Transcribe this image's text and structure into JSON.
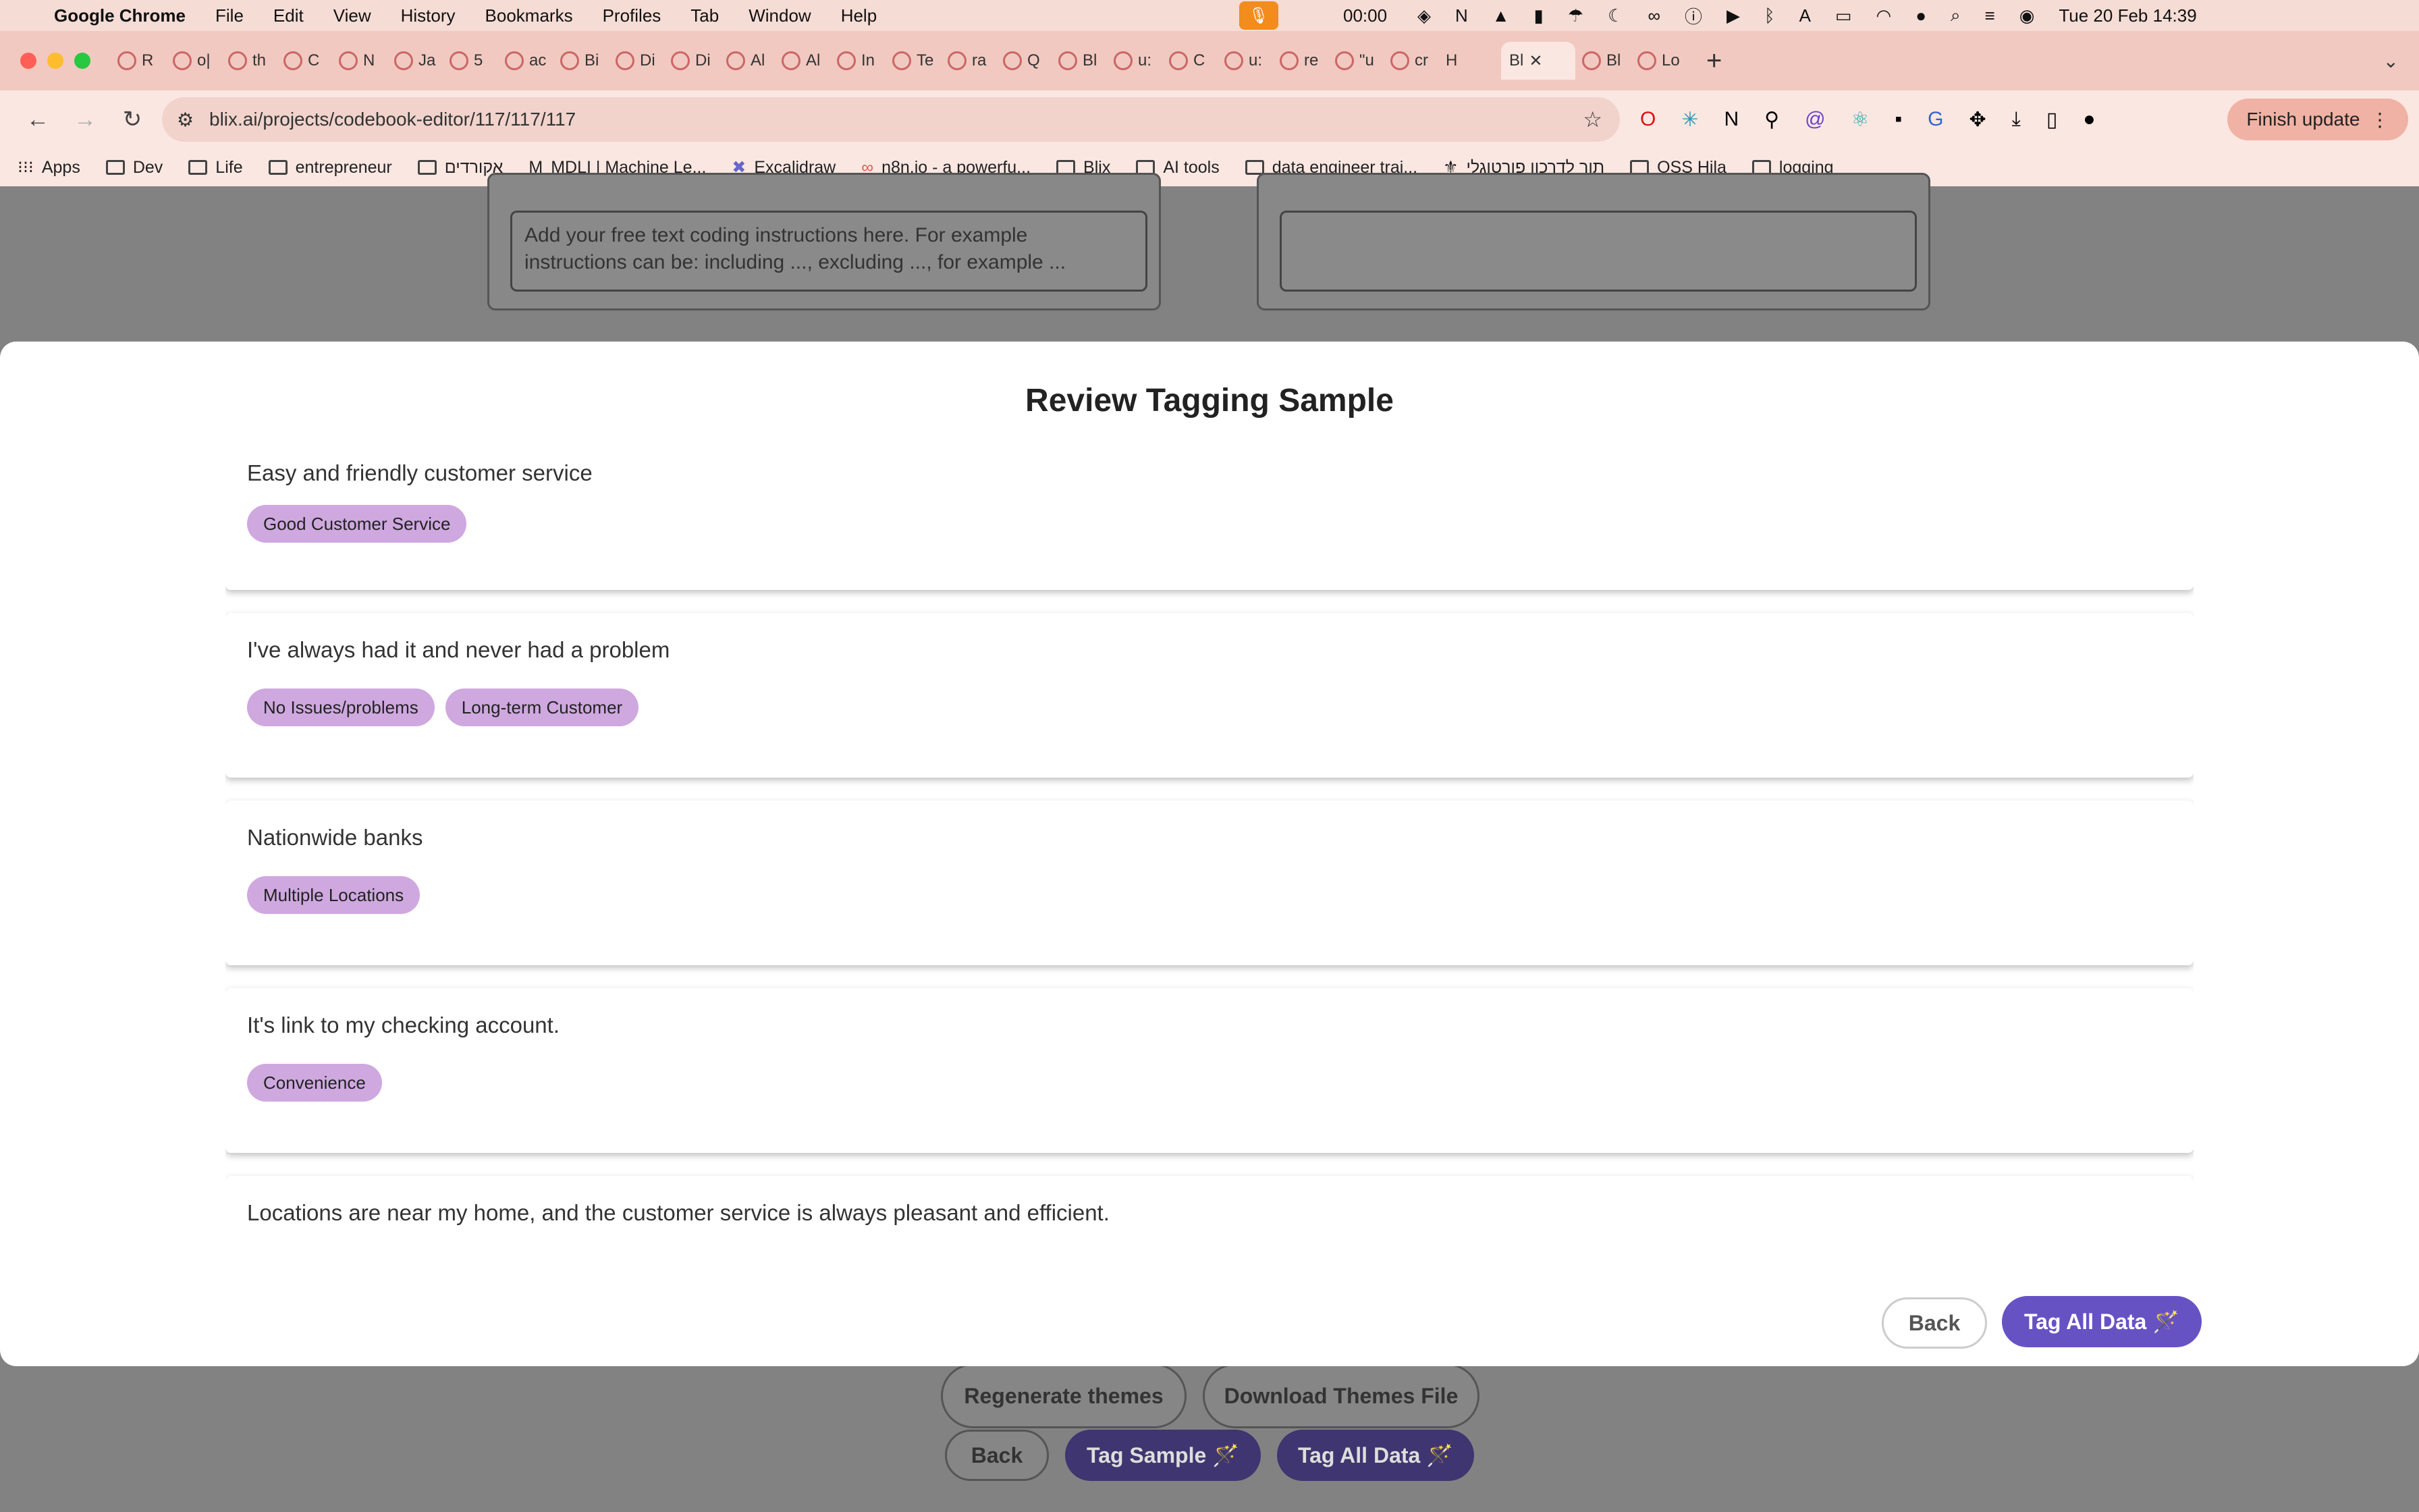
{
  "menubar": {
    "app": "Google Chrome",
    "items": [
      "File",
      "Edit",
      "View",
      "History",
      "Bookmarks",
      "Profiles",
      "Tab",
      "Window",
      "Help"
    ],
    "timer": "00:00",
    "datetime": "Tue 20 Feb  14:39"
  },
  "tabs": [
    "R",
    "o|",
    "th",
    "C",
    "N",
    "Ja",
    "5",
    "ac",
    "Bi",
    "Di",
    "Di",
    "Al",
    "Al",
    "In",
    "Te",
    "ra",
    "Q",
    "Bl",
    "u:",
    "C",
    "u:",
    "re",
    "\"u",
    "cr",
    "H",
    "Bl",
    "Bl",
    "Lo"
  ],
  "toolbar": {
    "url": "blix.ai/projects/codebook-editor/117/117/117",
    "finish_update": "Finish update"
  },
  "bookmarks": [
    "Apps",
    "Dev",
    "Life",
    "entrepreneur",
    "אקורדים",
    "MDLI | Machine Le...",
    "Excalidraw",
    "n8n.io - a powerfu...",
    "Blix",
    "AI tools",
    "data engineer trai...",
    "תור לדרכון פורטוגלי",
    "OSS Hila",
    "logging"
  ],
  "background": {
    "instructions_placeholder": "Add your free text coding instructions here. For example instructions can be: including ..., excluding ..., for example ...",
    "regenerate": "Regenerate themes",
    "download": "Download Themes File",
    "back": "Back",
    "tag_sample": "Tag Sample 🪄",
    "tag_all": "Tag All Data 🪄"
  },
  "modal": {
    "title": "Review Tagging Sample",
    "cards": [
      {
        "text": "Easy and friendly customer service",
        "tags": [
          "Good Customer Service"
        ]
      },
      {
        "text": "I've always had it and never had a problem",
        "tags": [
          "No Issues/problems",
          "Long-term Customer"
        ]
      },
      {
        "text": "Nationwide banks",
        "tags": [
          "Multiple Locations"
        ]
      },
      {
        "text": "It's link to my checking account.",
        "tags": [
          "Convenience"
        ]
      },
      {
        "text": "Locations are near my home, and the customer service is always pleasant and efficient.",
        "tags": []
      }
    ],
    "back": "Back",
    "tag_all": "Tag All Data 🪄"
  }
}
